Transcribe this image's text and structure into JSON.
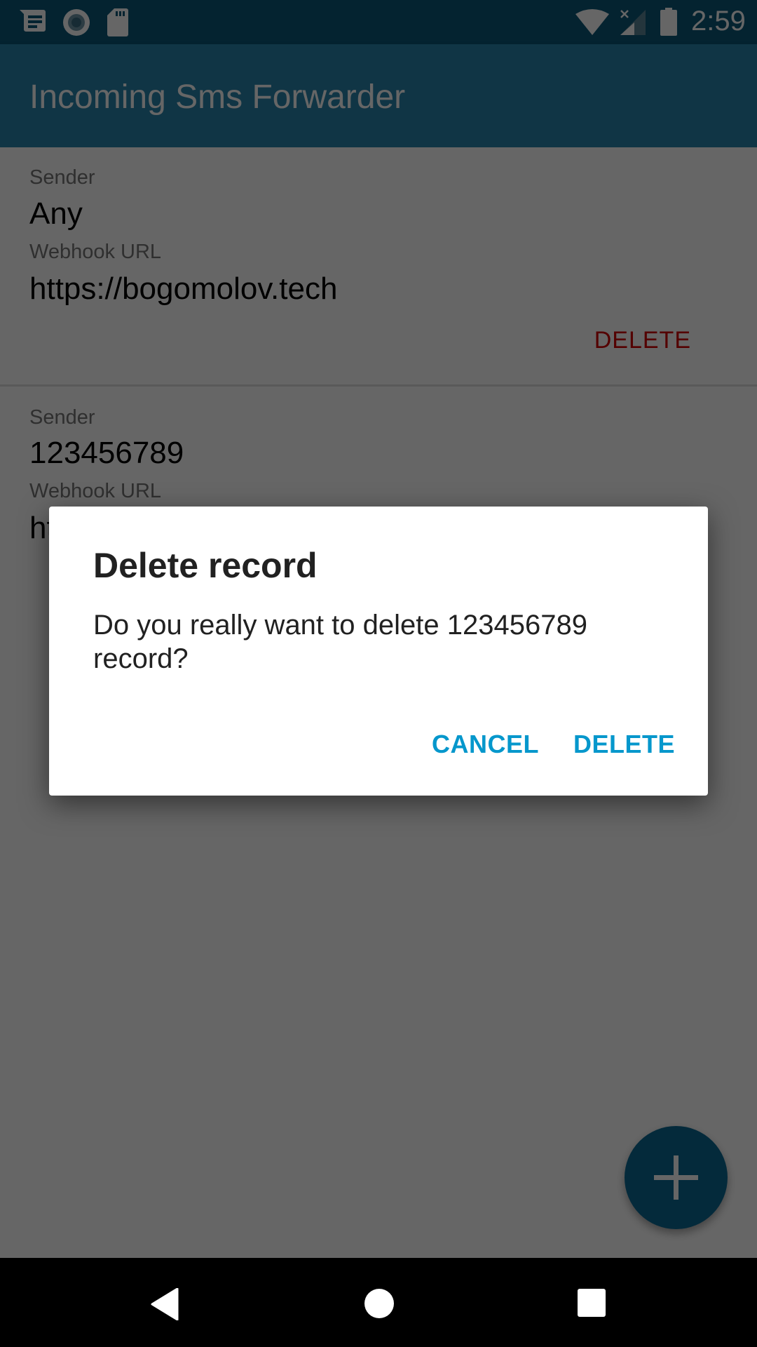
{
  "status_bar": {
    "time": "2:59",
    "left_icons": [
      "message-notification-icon",
      "record-icon",
      "sd-card-icon"
    ],
    "right_icons": [
      "wifi-icon",
      "cell-signal-no-data-icon",
      "battery-icon"
    ]
  },
  "app_bar": {
    "title": "Incoming Sms Forwarder"
  },
  "records": [
    {
      "sender_label": "Sender",
      "sender": "Any",
      "webhook_label": "Webhook URL",
      "webhook": "https://bogomolov.tech",
      "delete_label": "DELETE"
    },
    {
      "sender_label": "Sender",
      "sender": "123456789",
      "webhook_label": "Webhook URL",
      "webhook": "ht"
    }
  ],
  "fab": {
    "icon": "plus-icon"
  },
  "dialog": {
    "title": "Delete record",
    "message": "Do you really want to delete 123456789 record?",
    "cancel_label": "CANCEL",
    "confirm_label": "DELETE"
  },
  "nav_bar": {
    "icons": [
      "back-icon",
      "home-icon",
      "recents-icon"
    ]
  },
  "colors": {
    "primary": "#2a86ad",
    "primary_dark": "#0a5779",
    "accent": "#0597cc",
    "danger": "#d20000"
  }
}
